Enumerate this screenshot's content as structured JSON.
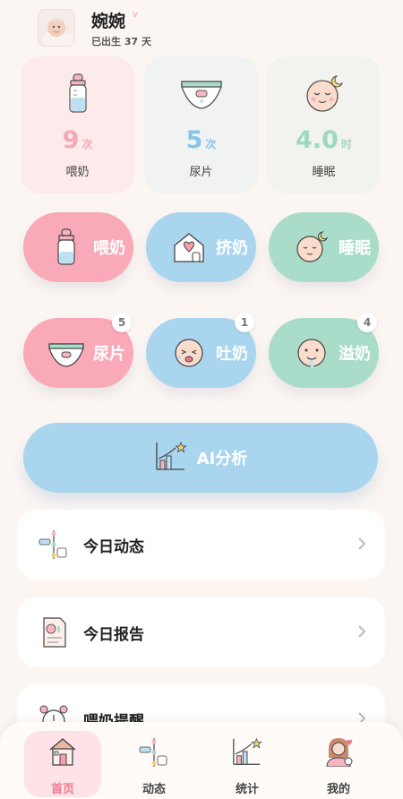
{
  "header": {
    "name": "婉婉",
    "gender_mark": "v",
    "age_text": "已出生 37 天"
  },
  "stats": [
    {
      "value": "9",
      "unit": "次",
      "label": "喂奶",
      "color": "#f6a8b5",
      "bg": "#fdeaea",
      "icon": "bottle-icon"
    },
    {
      "value": "5",
      "unit": "次",
      "label": "尿片",
      "color": "#89c4e6",
      "bg": "#f1f2f2",
      "icon": "diaper-icon"
    },
    {
      "value": "4.0",
      "unit": "时",
      "label": "睡眠",
      "color": "#9fd8c2",
      "bg": "#f2f3ef",
      "icon": "sleeping-baby-icon"
    }
  ],
  "actions": [
    {
      "label": "喂奶",
      "color": "#f9a9b7",
      "icon": "bottle-icon"
    },
    {
      "label": "挤奶",
      "color": "#a9d5ee",
      "icon": "pump-house-icon"
    },
    {
      "label": "睡眠",
      "color": "#a9dcc9",
      "icon": "sleeping-baby-icon"
    },
    {
      "label": "尿片",
      "color": "#f9a9b7",
      "icon": "diaper-icon",
      "badge": "5"
    },
    {
      "label": "吐奶",
      "color": "#a9d5ee",
      "icon": "crying-baby-icon",
      "badge": "1"
    },
    {
      "label": "溢奶",
      "color": "#a9dcc9",
      "icon": "spit-up-baby-icon",
      "badge": "4"
    }
  ],
  "ai_button": {
    "label": "AI分析",
    "icon": "chart-icon"
  },
  "list": [
    {
      "label": "今日动态",
      "icon": "timeline-icon"
    },
    {
      "label": "今日报告",
      "icon": "report-icon"
    },
    {
      "label": "喂奶提醒",
      "icon": "alarm-icon"
    }
  ],
  "nav": [
    {
      "label": "首页",
      "icon": "home-icon",
      "active": true
    },
    {
      "label": "动态",
      "icon": "timeline-icon"
    },
    {
      "label": "统计",
      "icon": "chart-icon"
    },
    {
      "label": "我的",
      "icon": "profile-icon"
    }
  ]
}
